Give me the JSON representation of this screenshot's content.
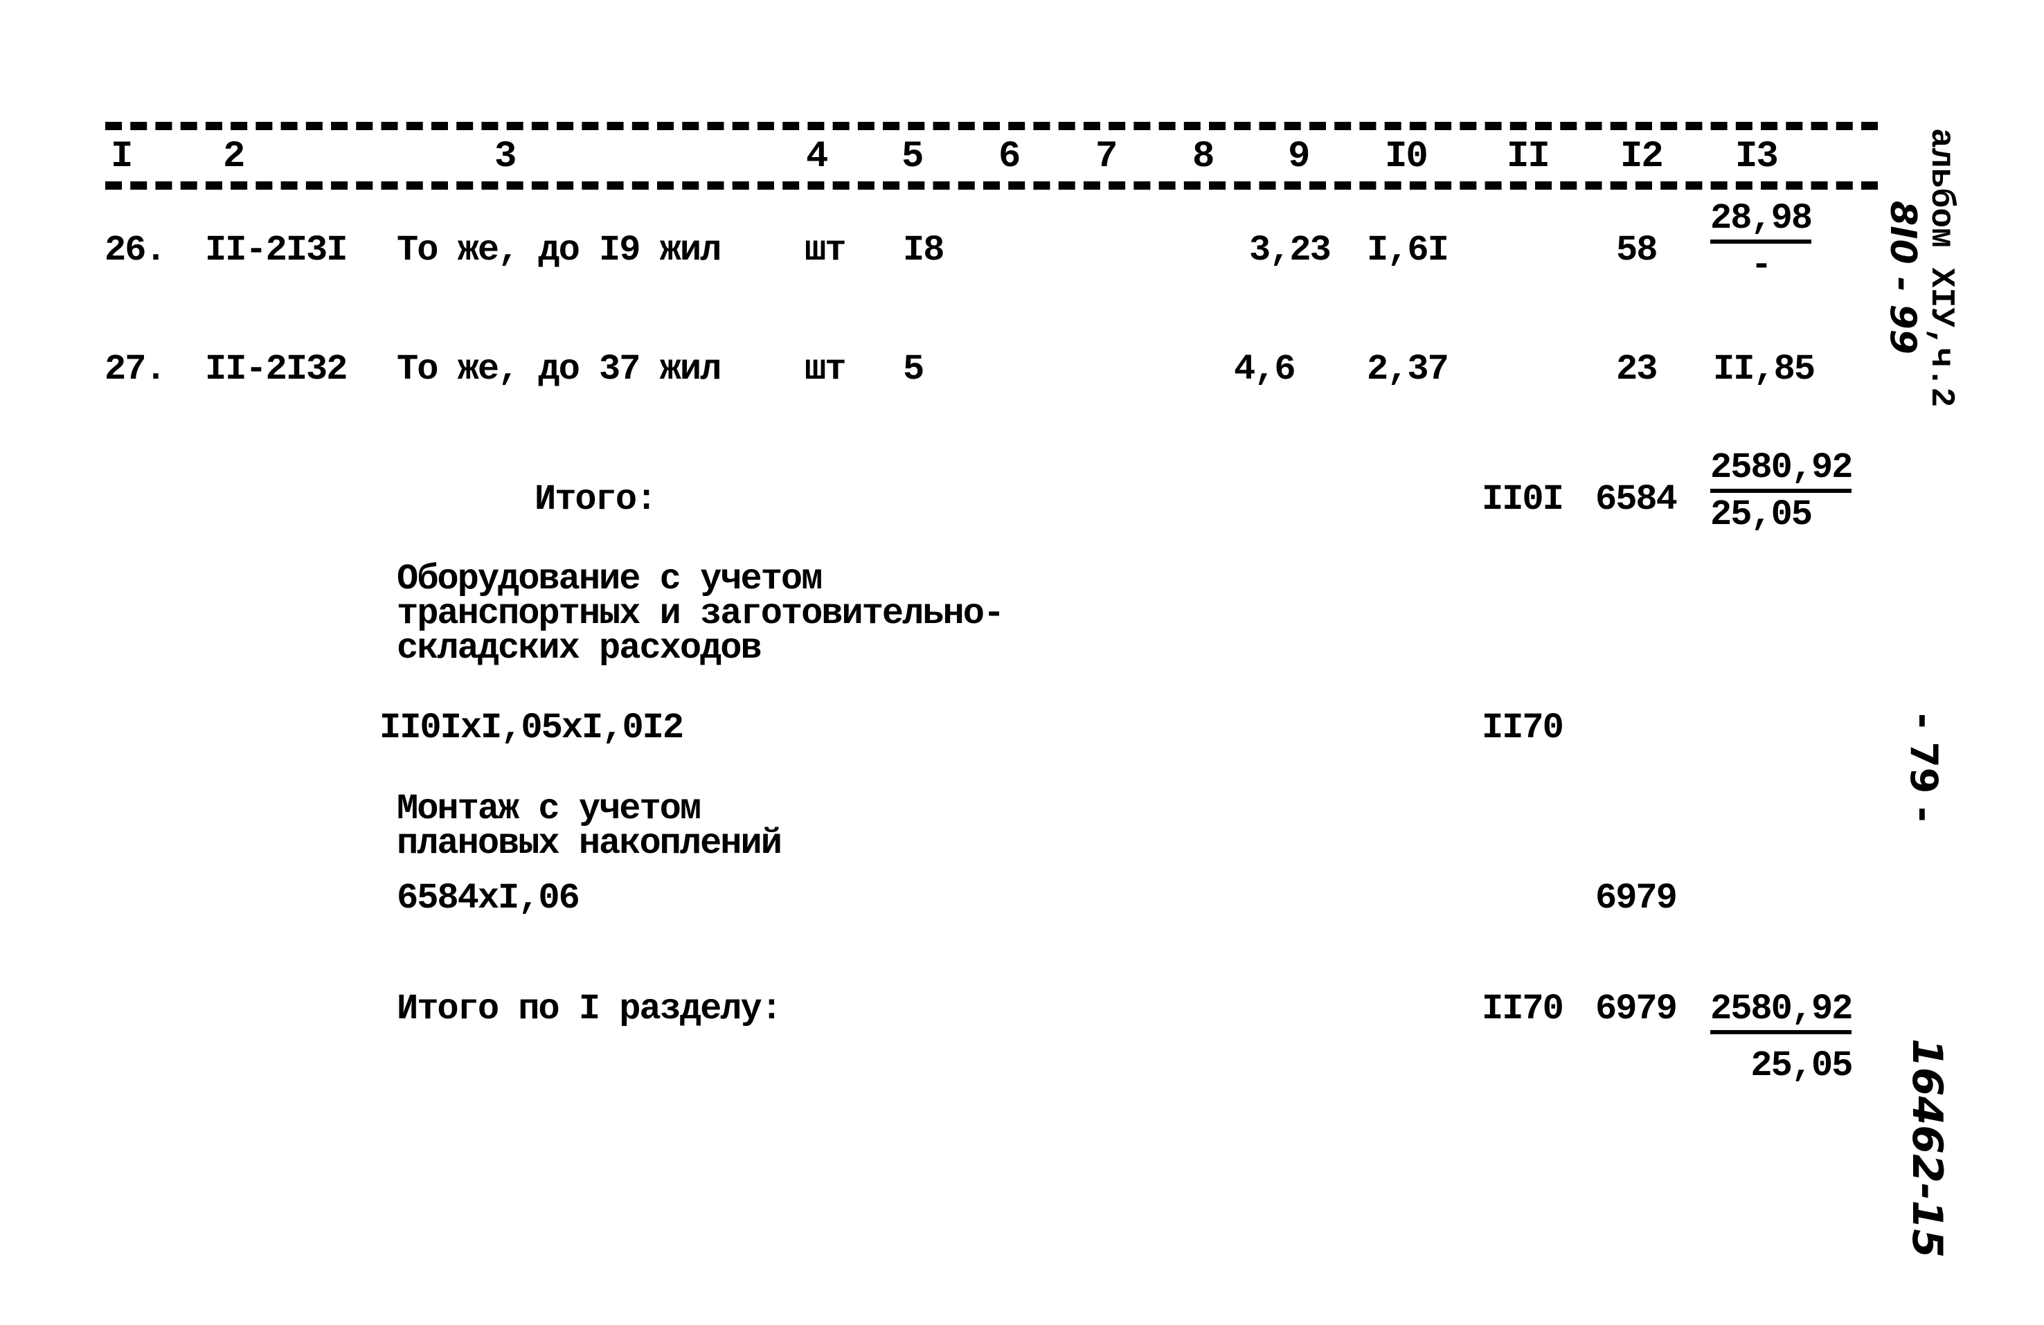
{
  "header": {
    "columns": [
      "I",
      "2",
      "3",
      "4",
      "5",
      "6",
      "7",
      "8",
      "9",
      "I0",
      "II",
      "I2",
      "I3"
    ]
  },
  "rows": [
    {
      "no": "26.",
      "code": "II-2I3I",
      "name": "То же, до I9 жил",
      "unit": "шт",
      "qty": "I8",
      "c9": "3,23",
      "c10": "I,6I",
      "c12": "58",
      "c13_num": "28,98",
      "c13_den": "-"
    },
    {
      "no": "27.",
      "code": "II-2I32",
      "name": "То же, до 37 жил",
      "unit": "шт",
      "qty": "5",
      "c9": "4,6",
      "c10": "2,37",
      "c12": "23",
      "c13": "II,85"
    }
  ],
  "subtotal": {
    "label": "Итого:",
    "c11": "II0I",
    "c12": "6584",
    "c13_num": "2580,92",
    "c13_den": "25,05"
  },
  "equipment": {
    "lines": [
      "Оборудование с учетом",
      "транспортных и заготовительно-",
      "складских расходов"
    ],
    "formula": "II0IxI,05xI,0I2",
    "c11": "II70"
  },
  "installation": {
    "lines": [
      "Монтаж с учетом",
      "плановых накоплений"
    ],
    "formula": "6584xI,06",
    "c12": "6979"
  },
  "section_total": {
    "label": "Итого по I разделу:",
    "c11": "II70",
    "c12": "6979",
    "c13_num": "2580,92",
    "c13_den": "25,05"
  },
  "margin": {
    "album": "альбом XIУ,ч.2",
    "album_code": "8I0 - 99",
    "page_number": "- 79 -",
    "stamp": "16462-15"
  }
}
